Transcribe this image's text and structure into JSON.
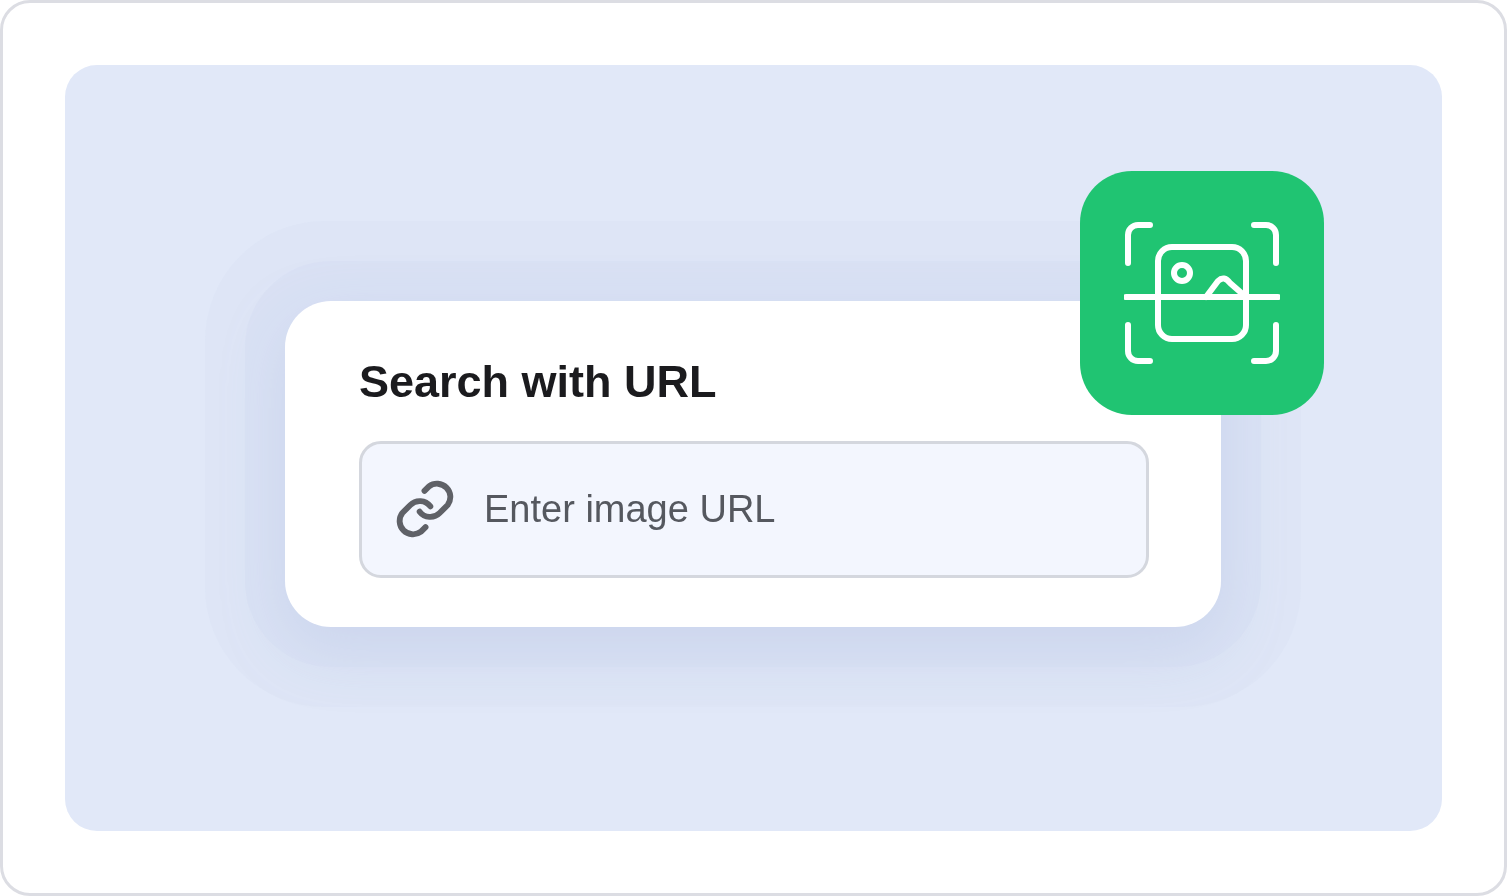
{
  "card": {
    "title": "Search with URL",
    "url_field": {
      "placeholder": "Enter image URL"
    }
  }
}
